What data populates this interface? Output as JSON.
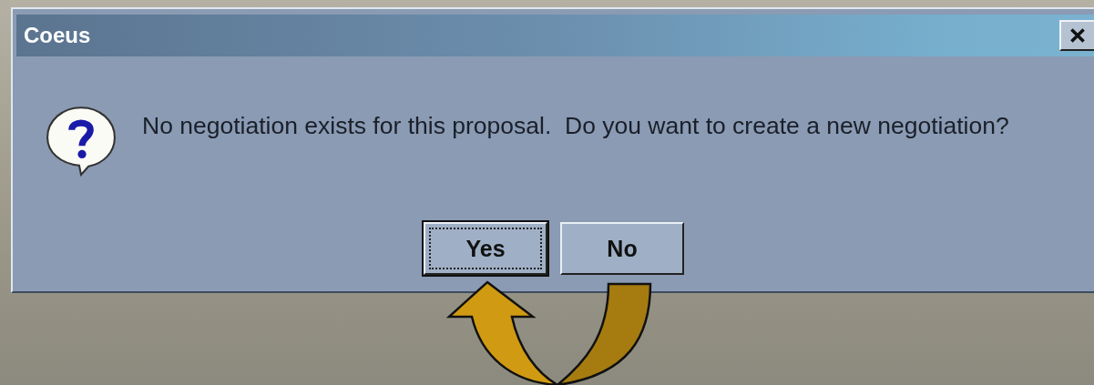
{
  "window": {
    "title": "Coeus"
  },
  "message": "No negotiation exists for this proposal.  Do you want to create a new negotiation?",
  "buttons": [
    {
      "label": "Yes",
      "selected": true
    },
    {
      "label": "No",
      "selected": false
    }
  ]
}
